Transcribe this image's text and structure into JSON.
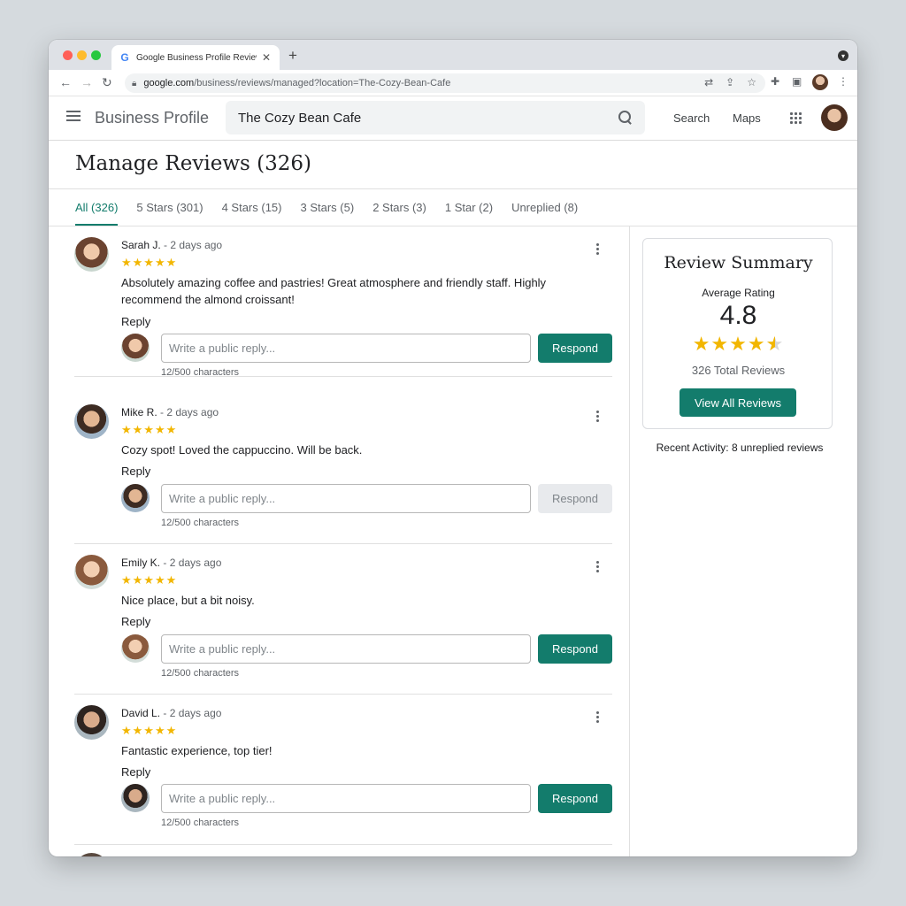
{
  "browser": {
    "tab_title": "Google Business Profile Review",
    "favicon": "G",
    "url_domain": "google.com",
    "url_path": "/business/reviews/managed?location=The-Cozy-Bean-Cafe"
  },
  "header": {
    "brand": "Business Profile",
    "search_value": "The Cozy Bean Cafe",
    "links": [
      "Search",
      "Maps"
    ]
  },
  "page": {
    "title": "Manage Reviews (326)"
  },
  "tabs": [
    {
      "label": "All (326)",
      "active": true
    },
    {
      "label": "5 Stars (301)"
    },
    {
      "label": "4 Stars (15)"
    },
    {
      "label": "3 Stars (5)"
    },
    {
      "label": "2 Stars (3)"
    },
    {
      "label": "1 Star (2)"
    },
    {
      "label": "Unreplied (8)"
    }
  ],
  "reviews": [
    {
      "author": "Sarah J.",
      "ago": "- 2 days ago",
      "stars": "★★★★★",
      "text": "Absolutely amazing coffee and pastries! Great atmosphere and friendly staff. Highly recommend the almond croissant!",
      "reply_label": "Reply",
      "reply_placeholder": "Write a public reply...",
      "respond_label": "Respond",
      "char_count": "12/500 characters"
    },
    {
      "author": "Mike R.",
      "ago": "- 2 days ago",
      "stars": "★★★★★",
      "text": "Cozy spot! Loved the cappuccino. Will be back.",
      "reply_label": "Reply",
      "reply_placeholder": "Write a public reply...",
      "respond_label": "Respond",
      "char_count": "12/500 characters"
    },
    {
      "author": "Emily K.",
      "ago": "- 2 days ago",
      "stars": "★★★★★",
      "text": "Nice place, but a bit noisy.",
      "reply_label": "Reply",
      "reply_placeholder": "Write a public reply...",
      "respond_label": "Respond",
      "char_count": "12/500 characters"
    },
    {
      "author": "David L.",
      "ago": "- 2 days ago",
      "stars": "★★★★★",
      "text": "Fantastic experience, top tier!",
      "reply_label": "Reply",
      "reply_placeholder": "Write a public reply...",
      "respond_label": "Respond",
      "char_count": "12/500 characters"
    }
  ],
  "summary": {
    "title": "Review Summary",
    "avg_label": "Average Rating",
    "avg_value": "4.8",
    "stars_full": "★★★★",
    "total": "326 Total Reviews",
    "view_all_label": "View All Reviews",
    "recent_activity": "Recent Activity: 8 unreplied reviews"
  },
  "colors": {
    "accent": "#137c6c",
    "star": "#f2b600"
  }
}
